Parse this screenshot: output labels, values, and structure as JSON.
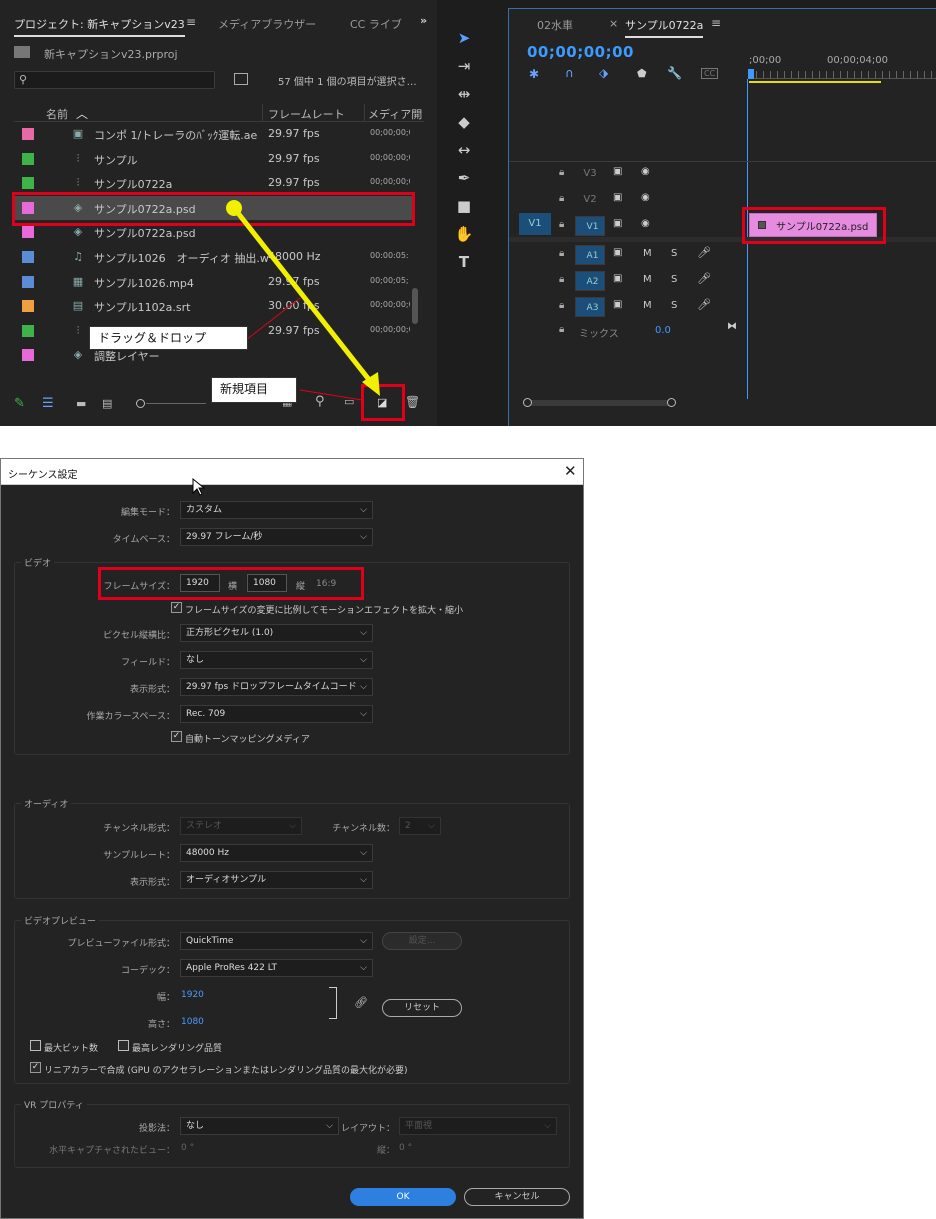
{
  "project": {
    "tab_title": "プロジェクト: 新キャプションv23",
    "tab_media": "メディアブラウザー",
    "tab_cc": "CC ライブ",
    "file": "新キャプションv23.prproj",
    "status": "57 個中 1 個の項目が選択さ…",
    "col_name": "名前",
    "col_frame": "フレームレート",
    "col_media": "メディア開",
    "items": [
      {
        "name": "コンポ 1/トレーラのﾊﾞｯｸ運転.ae",
        "fps": "29.97 fps",
        "media": "00;00;00;0",
        "color": "#e76aa6",
        "icon": "comp"
      },
      {
        "name": "サンプル",
        "fps": "29.97 fps",
        "media": "00;00;00;0",
        "color": "#3fb24a",
        "icon": "seq"
      },
      {
        "name": "サンプル0722a",
        "fps": "29.97 fps",
        "media": "00;00;00;0",
        "color": "#3fb24a",
        "icon": "seq"
      },
      {
        "name": "サンプル0722a.psd",
        "fps": "",
        "media": "",
        "color": "#e76ad8",
        "icon": "psd"
      },
      {
        "name": "サンプル0722a.psd",
        "fps": "",
        "media": "",
        "color": "#e76ad8",
        "icon": "psd"
      },
      {
        "name": "サンプル1026　オーディオ 抽出.w",
        "fps": "48000 Hz",
        "media": "00:00:05:",
        "color": "#5b8dd6",
        "icon": "audio"
      },
      {
        "name": "サンプル1026.mp4",
        "fps": "29.97 fps",
        "media": "00;00;05;",
        "color": "#5b8dd6",
        "icon": "video"
      },
      {
        "name": "サンプル1102a.srt",
        "fps": "30.00 fps",
        "media": "00;00;00;0",
        "color": "#f0a040",
        "icon": "srt"
      },
      {
        "name": "",
        "fps": "29.97 fps",
        "media": "00;00;00;0",
        "color": "#3fb24a",
        "icon": "seq"
      },
      {
        "name": "調整レイヤー",
        "fps": "",
        "media": "",
        "color": "#e76ad8",
        "icon": "adj"
      }
    ]
  },
  "callouts": {
    "drag": "ドラッグ＆ドロップ",
    "new_item": "新規項目"
  },
  "timeline": {
    "tab_prev": "02水車",
    "tab_active": "サンプル0722a",
    "timecode": "00;00;00;00",
    "ruler": [
      ";00;00",
      "00;00;04;00"
    ],
    "video_tracks": [
      "V3",
      "V2",
      "V1"
    ],
    "audio_tracks": [
      "A1",
      "A2",
      "A3"
    ],
    "source_patch": "V1",
    "mix_label": "ミックス",
    "mix_value": "0.0",
    "m": "M",
    "s": "S",
    "clip": "サンプル0722a.psd"
  },
  "dialog": {
    "title": "シーケンス設定",
    "edit_mode_label": "編集モード：",
    "edit_mode": "カスタム",
    "timebase_label": "タイムベース：",
    "timebase": "29.97  フレーム/秒",
    "video_group": "ビデオ",
    "frame_size_label": "フレームサイズ：",
    "width": "1920",
    "width_label": "横",
    "height": "1080",
    "height_label": "縦",
    "aspect": "16:9",
    "scale_motion": "フレームサイズの変更に比例してモーションエフェクトを拡大・縮小",
    "pixel_aspect_label": "ピクセル縦横比：",
    "pixel_aspect": "正方形ピクセル (1.0)",
    "field_label": "フィールド：",
    "field": "なし",
    "display_format_label": "表示形式：",
    "display_format": "29.97  fps ドロップフレームタイムコード",
    "color_space_label": "作業カラースペース：",
    "color_space": "Rec. 709",
    "tone_map": "自動トーンマッピングメディア",
    "audio_group": "オーディオ",
    "channel_format_label": "チャンネル形式：",
    "channel_format": "ステレオ",
    "channels_label": "チャンネル数：",
    "channels": "2",
    "sample_rate_label": "サンプルレート：",
    "sample_rate": "48000 Hz",
    "audio_display_label": "表示形式：",
    "audio_display": "オーディオサンプル",
    "preview_group": "ビデオプレビュー",
    "preview_format_label": "プレビューファイル形式：",
    "preview_format": "QuickTime",
    "settings_button": "設定...",
    "codec_label": "コーデック：",
    "codec": "Apple ProRes 422 LT",
    "pw_label": "幅：",
    "pw": "1920",
    "ph_label": "高さ：",
    "ph": "1080",
    "reset_button": "リセット",
    "max_bit": "最大ビット数",
    "max_render": "最高レンダリング品質",
    "linear_color": "リニアカラーで合成 (GPU のアクセラレーションまたはレンダリング品質の最大化が必要)",
    "vr_group": "VR プロパティ",
    "projection_label": "投影法：",
    "projection": "なし",
    "layout_label": "レイアウト：",
    "layout": "平面視",
    "hcap_label": "水平キャプチャされたビュー：",
    "hcap": "0 °",
    "vert_label": "縦：",
    "vert": "0 °",
    "ok": "OK",
    "cancel": "キャンセル"
  }
}
